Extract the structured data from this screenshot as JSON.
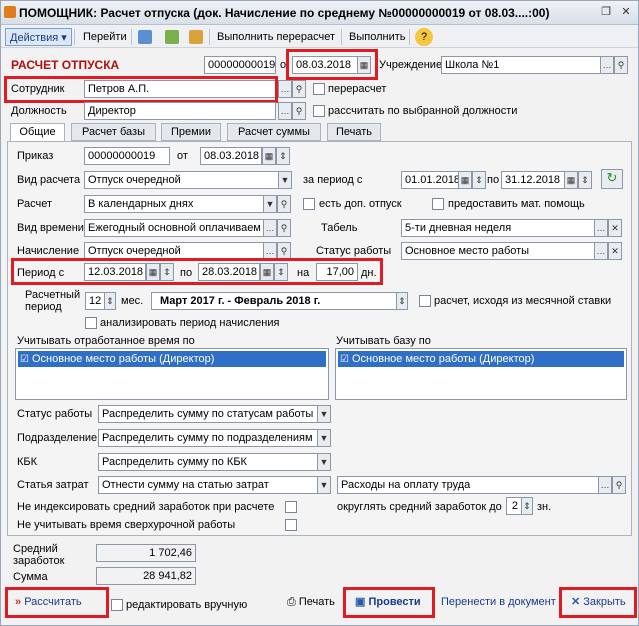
{
  "window": {
    "title": "ПОМОЩНИК: Расчет отпуска (док. Начисление по среднему №00000000019 от 08.03....:00)"
  },
  "toolbar": {
    "actions": "Действия",
    "go": "Перейти",
    "recalc": "Выполнить перерасчет",
    "execute": "Выполнить",
    "help": "?"
  },
  "header": {
    "doc_title": "РАСЧЕТ ОТПУСКА",
    "number": "00000000019",
    "from_label": "о",
    "date": "08.03.2018",
    "institution_label": "Учреждение",
    "institution": "Школа №1",
    "employee_label": "Сотрудник",
    "employee": "Петров А.П.",
    "recalc_label": "перерасчет",
    "position_label": "Должность",
    "position": "Директор",
    "by_position_label": "рассчитать по выбранной должности"
  },
  "tabs": [
    "Общие",
    "Расчет базы",
    "Премии",
    "Расчет суммы",
    "Печать"
  ],
  "general": {
    "order_label": "Приказ",
    "order_number": "00000000019",
    "order_from": "от",
    "order_date": "08.03.2018",
    "calc_type_label": "Вид расчета",
    "calc_type": "Отпуск очередной",
    "for_period_label": "за период с",
    "period_from": "01.01.2018",
    "period_to_label": "по",
    "period_to": "31.12.2018",
    "calc_label": "Расчет",
    "calc": "В календарных днях",
    "extra_leave_label": "есть доп. отпуск",
    "mat_help_label": "предоставить мат. помощь",
    "time_type_label": "Вид времени",
    "time_type": "Ежегодный основной оплачиваем",
    "tabel_label": "Табель",
    "tabel": "5-ти дневная неделя",
    "accrual_label": "Начисление",
    "accrual": "Отпуск очередной",
    "work_status_label": "Статус работы",
    "work_status": "Основное место работы",
    "leave_from_label": "Период с",
    "leave_from": "12.03.2018",
    "leave_to_label": "по",
    "leave_to": "28.03.2018",
    "leave_on_label": "на",
    "leave_days": "17,00",
    "days_label": "дн.",
    "calc_period_label": "Расчетный период",
    "calc_period_months": "12",
    "months_label": "мес.",
    "calc_period_text": "Март 2017 г. - Февраль 2018 г.",
    "monthly_rate_label": "расчет, исходя из месячной ставки",
    "analyze_label": "анализировать период начисления",
    "worked_time_label": "Учитывать отработанное время по",
    "worked_time_item": "Основное место работы (Директор)",
    "base_label": "Учитывать базу по",
    "base_item": "Основное место работы (Директор)",
    "status_label": "Статус работы",
    "status_dist": "Распределить сумму по статусам работы",
    "dept_label": "Подразделение",
    "dept_dist": "Распределить сумму по подразделениям",
    "kbk_label": "КБК",
    "kbk_dist": "Распределить сумму по КБК",
    "cost_label": "Статья затрат",
    "cost_dist": "Отнести сумму на статью затрат",
    "cost_item": "Расходы на оплату труда",
    "no_index_label": "Не индексировать средний заработок при расчете",
    "no_overtime_label": "Не учитывать время сверхурочной работы",
    "round_label": "округлять средний заработок до",
    "round_value": "2",
    "round_unit": "зн."
  },
  "totals": {
    "avg_label": "Средний заработок",
    "avg_value": "1 702,46",
    "sum_label": "Сумма",
    "sum_value": "28 941,82"
  },
  "footer": {
    "calculate": "Рассчитать",
    "edit_manual": "редактировать вручную",
    "print": "Печать",
    "post": "Провести",
    "transfer": "Перенести в документ",
    "close": "Закрыть"
  }
}
